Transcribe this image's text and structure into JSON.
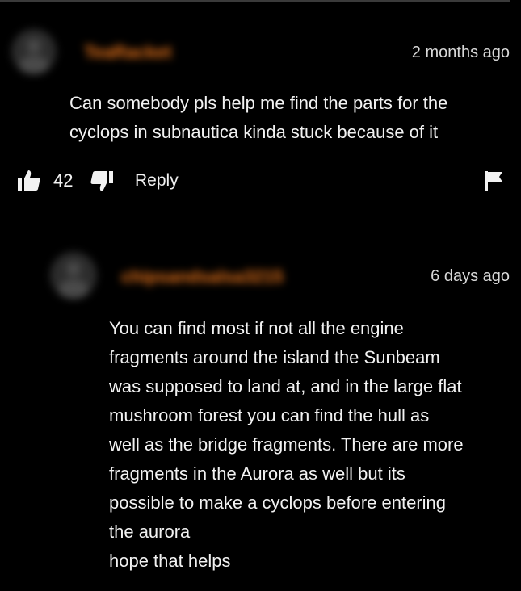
{
  "comment": {
    "username": "TeaRacket",
    "timestamp": "2 months ago",
    "body_lines": [
      "Can somebody pls help me find the parts for the",
      "cyclops in subnautica kinda stuck because of it"
    ],
    "likes": "42",
    "reply_label": "Reply",
    "icons": {
      "like": "thumbs-up-icon",
      "dislike": "thumbs-down-icon",
      "flag": "flag-icon"
    }
  },
  "reply": {
    "username": "chipsandsalsa3215",
    "timestamp": "6 days ago",
    "body_lines": [
      "You can find most if not all the engine",
      "fragments around the island the Sunbeam",
      "was supposed to land at, and in the large flat",
      "mushroom forest you can find the hull as",
      "well as the bridge fragments. There are more",
      "fragments in the Aurora as well but its",
      "possible to make a cyclops before entering",
      "the aurora",
      "hope that helps"
    ]
  },
  "colors": {
    "background": "#000000",
    "text": "#f2f2f2",
    "username": "#e8731a",
    "divider": "#3a3a3a"
  }
}
